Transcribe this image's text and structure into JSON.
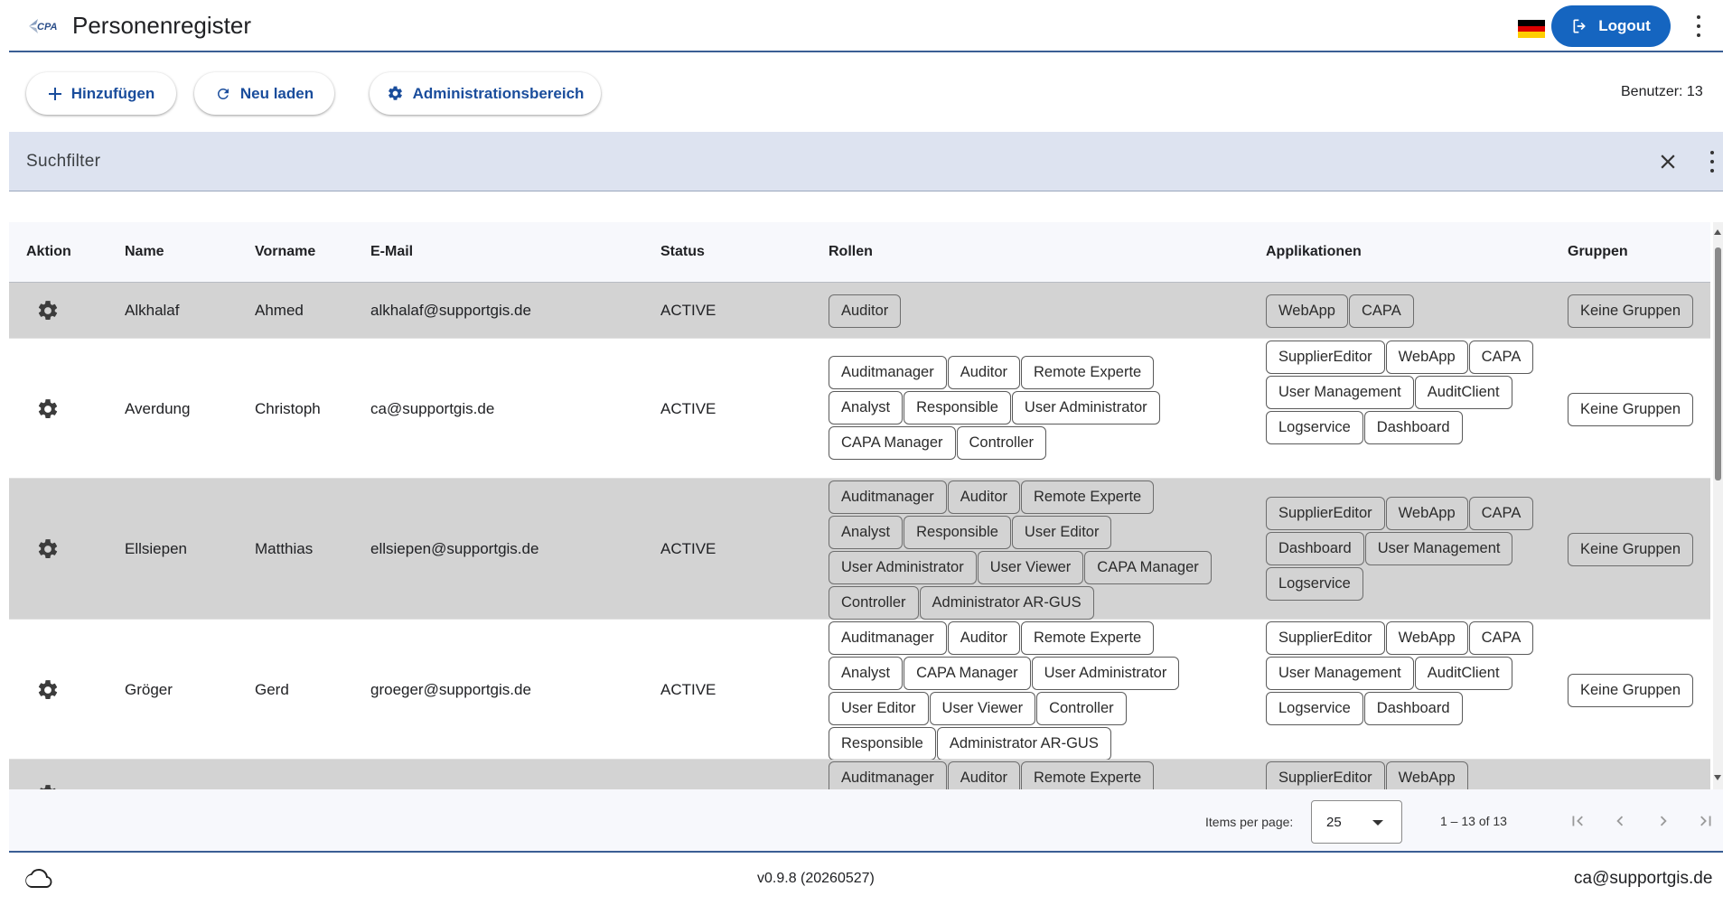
{
  "header": {
    "title": "Personenregister",
    "logo_text": "CPA",
    "logout_label": "Logout",
    "language": "de"
  },
  "toolbar": {
    "add_label": "Hinzufügen",
    "reload_label": "Neu laden",
    "admin_label": "Administrationsbereich",
    "user_count": "Benutzer: 13"
  },
  "filter": {
    "label": "Suchfilter"
  },
  "table": {
    "columns": [
      "Aktion",
      "Name",
      "Vorname",
      "E-Mail",
      "Status",
      "Rollen",
      "Applikationen",
      "Gruppen"
    ],
    "rows": [
      {
        "name": "Alkhalaf",
        "vorname": "Ahmed",
        "email": "alkhalaf@supportgis.de",
        "status": "ACTIVE",
        "roles": [
          "Auditor"
        ],
        "apps": [
          "WebApp",
          "CAPA"
        ],
        "groups": "Keine Gruppen"
      },
      {
        "name": "Averdung",
        "vorname": "Christoph",
        "email": "ca@supportgis.de",
        "status": "ACTIVE",
        "roles": [
          "Auditmanager",
          "Auditor",
          "Remote Experte",
          "Analyst",
          "Responsible",
          "User Administrator",
          "CAPA Manager",
          "Controller"
        ],
        "apps": [
          "SupplierEditor",
          "WebApp",
          "CAPA",
          "User Management",
          "AuditClient",
          "Logservice",
          "Dashboard"
        ],
        "groups": "Keine Gruppen"
      },
      {
        "name": "Ellsiepen",
        "vorname": "Matthias",
        "email": "ellsiepen@supportgis.de",
        "status": "ACTIVE",
        "roles": [
          "Auditmanager",
          "Auditor",
          "Remote Experte",
          "Analyst",
          "Responsible",
          "User Editor",
          "User Administrator",
          "User Viewer",
          "CAPA Manager",
          "Controller",
          "Administrator AR-GUS"
        ],
        "apps": [
          "SupplierEditor",
          "WebApp",
          "CAPA",
          "Dashboard",
          "User Management",
          "Logservice"
        ],
        "groups": "Keine Gruppen"
      },
      {
        "name": "Gröger",
        "vorname": "Gerd",
        "email": "groeger@supportgis.de",
        "status": "ACTIVE",
        "roles": [
          "Auditmanager",
          "Auditor",
          "Remote Experte",
          "Analyst",
          "CAPA Manager",
          "User Administrator",
          "User Editor",
          "User Viewer",
          "Controller",
          "Responsible",
          "Administrator AR-GUS"
        ],
        "apps": [
          "SupplierEditor",
          "WebApp",
          "CAPA",
          "User Management",
          "AuditClient",
          "Logservice",
          "Dashboard"
        ],
        "groups": "Keine Gruppen"
      },
      {
        "name": "",
        "vorname": "",
        "email": "",
        "status": "",
        "roles": [
          "Auditmanager",
          "Auditor",
          "Remote Experte"
        ],
        "apps": [
          "SupplierEditor",
          "WebApp"
        ],
        "groups": ""
      }
    ]
  },
  "paginator": {
    "items_per_page_label": "Items per page:",
    "items_per_page_value": "25",
    "range_label": "1 – 13 of 13"
  },
  "footer": {
    "version": "v0.9.8 (20260527)",
    "email": "ca@supportgis.de"
  },
  "colors": {
    "primary": "#1565c0",
    "accent_line": "#3a5e94",
    "filter_bg": "#dde3f0",
    "row_alt": "#d3d3d3"
  }
}
